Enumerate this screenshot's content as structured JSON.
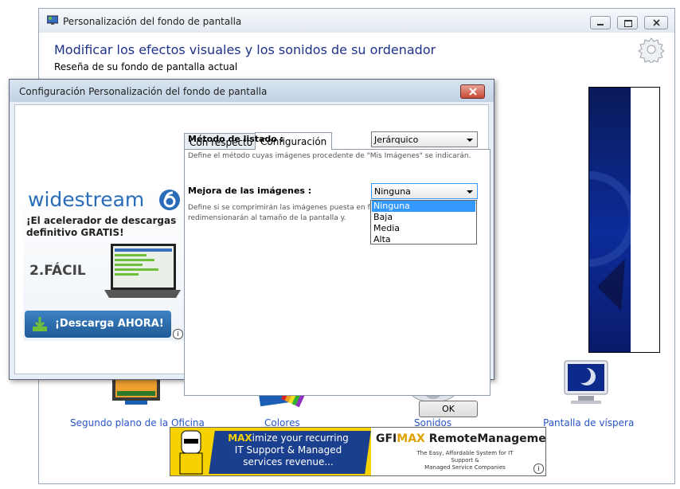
{
  "main_window": {
    "title": "Personalización del fondo de pantalla",
    "headline": "Modificar los efectos visuales y los sonidos de su ordenador",
    "subheading": "Reseña de su fondo de pantalla actual",
    "tiles": [
      {
        "label": "Segundo plano de la Oficina"
      },
      {
        "label": "Colores"
      },
      {
        "label": "Sonidos"
      },
      {
        "label": "Pantalla de víspera"
      }
    ]
  },
  "bottom_ad": {
    "headline_prefix": "MAX",
    "headline_rest": "imize your recurring",
    "line2": "IT Support & Managed",
    "line3": "services revenue...",
    "brand_gfi": "GFI",
    "brand_max": "MAX",
    "brand_rm": "RemoteManagement",
    "tm": "™",
    "tagline1": "The Easy, Affordable System for IT Support &",
    "tagline2": "Managed Service Companies",
    "info": "i"
  },
  "dialog": {
    "title": "Configuración Personalización del fondo de pantalla",
    "tabs": [
      {
        "label": "Con respecto a",
        "active": false
      },
      {
        "label": "Configuración",
        "active": true
      }
    ],
    "listing_method": {
      "label": "Método de listado :",
      "value": "Jerárquico",
      "description": "Define el método cuyas imágenes procedente de \"Mis Imágenes\" se indicarán."
    },
    "image_enhancement": {
      "label": "Mejora de las imágenes :",
      "value": "Ninguna",
      "description_line1": "Define si se comprimirán las imágenes puesta en fon",
      "description_line2": "redimensionarán al tamaño de la pantalla y.",
      "options": [
        "Ninguna",
        "Baja",
        "Media",
        "Alta"
      ],
      "selected_index": 0
    },
    "ok_label": "OK"
  },
  "side_ad": {
    "brand_wide": "wide",
    "brand_stream": "stream",
    "headline_line1": "¡El acelerador de descargas",
    "headline_line2": "definitivo GRATIS!",
    "step": "2.FÁCIL",
    "button": "¡Descarga AHORA!",
    "info": "i"
  },
  "colors": {
    "headline": "#1e3287",
    "link": "#2a55c8",
    "selection": "#3399ff",
    "ad_yellow": "#f5d200",
    "ad_blue": "#1a3f8f",
    "widestream_blue": "#2a6cb8",
    "button_blue": "#2b6aa8"
  }
}
